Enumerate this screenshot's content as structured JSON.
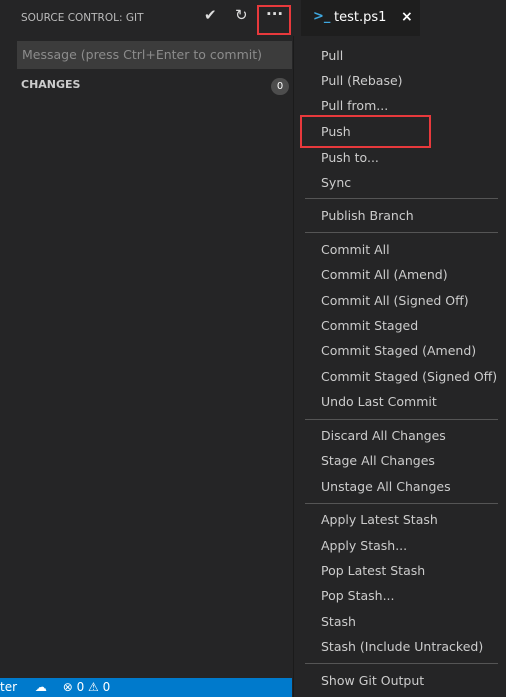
{
  "panel": {
    "title": "SOURCE CONTROL: GIT",
    "commit_icon": "check-icon",
    "refresh_icon": "refresh-icon",
    "more_icon": "ellipsis-icon",
    "message_placeholder": "Message (press Ctrl+Enter to commit)",
    "changes_label": "CHANGES",
    "changes_count": "0"
  },
  "tab": {
    "label": "test.ps1",
    "icon": "powershell-icon",
    "close": "×"
  },
  "status": {
    "branch_fragment": "ter",
    "sync_icon": "cloud-upload-icon",
    "errors": "0",
    "warnings": "0"
  },
  "menu": {
    "groups": [
      [
        "Pull",
        "Pull (Rebase)",
        "Pull from...",
        "Push",
        "Push to...",
        "Sync"
      ],
      [
        "Publish Branch"
      ],
      [
        "Commit All",
        "Commit All (Amend)",
        "Commit All (Signed Off)",
        "Commit Staged",
        "Commit Staged (Amend)",
        "Commit Staged (Signed Off)",
        "Undo Last Commit"
      ],
      [
        "Discard All Changes",
        "Stage All Changes",
        "Unstage All Changes"
      ],
      [
        "Apply Latest Stash",
        "Apply Stash...",
        "Pop Latest Stash",
        "Pop Stash...",
        "Stash",
        "Stash (Include Untracked)"
      ],
      [
        "Show Git Output"
      ]
    ],
    "highlighted": "Push"
  },
  "colors": {
    "highlight": "#e8393c",
    "status_bar": "#007acc"
  }
}
